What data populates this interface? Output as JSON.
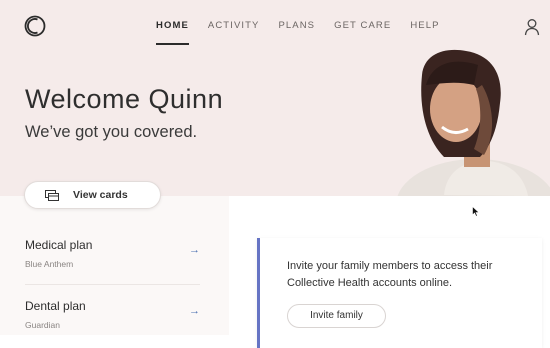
{
  "nav": {
    "items": [
      {
        "label": "HOME",
        "active": true
      },
      {
        "label": "ACTIVITY"
      },
      {
        "label": "PLANS"
      },
      {
        "label": "GET CARE"
      },
      {
        "label": "HELP"
      }
    ]
  },
  "hero": {
    "title": "Welcome Quinn",
    "subtitle": "We’ve got you covered.",
    "view_cards_label": "View cards"
  },
  "plans": [
    {
      "title": "Medical plan",
      "provider": "Blue Anthem",
      "icon": "arrow-right-icon"
    },
    {
      "title": "Dental plan",
      "provider": "Guardian",
      "icon": "arrow-right-icon"
    }
  ],
  "invite": {
    "text": "Invite your family members to access their Collective Health accounts online.",
    "button_label": "Invite family"
  },
  "colors": {
    "hero_bg": "#f5ebea",
    "accent": "#6674c4",
    "arrow": "#4a6fb0"
  }
}
